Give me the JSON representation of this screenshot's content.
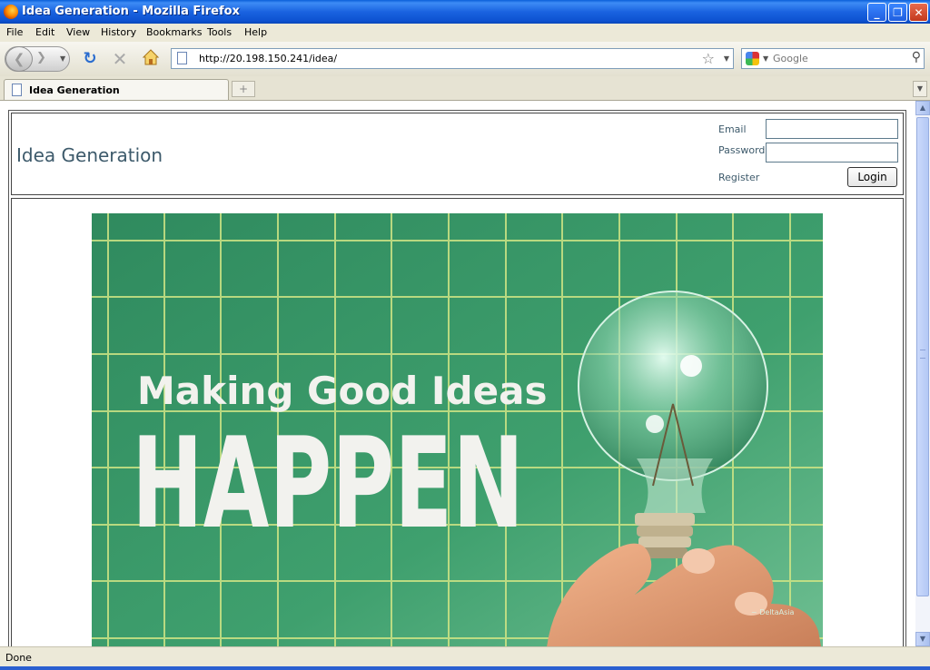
{
  "window": {
    "title": "Idea Generation - Mozilla Firefox",
    "minimize": "_",
    "maximize": "❐",
    "close": "✕"
  },
  "menu": [
    "File",
    "Edit",
    "View",
    "History",
    "Bookmarks",
    "Tools",
    "Help"
  ],
  "toolbar": {
    "url": "http://20.198.150.241/idea/",
    "search_placeholder": "Google"
  },
  "tab": {
    "label": "Idea Generation",
    "new_tab": "+"
  },
  "page": {
    "site_title": "Idea Generation",
    "email_label": "Email",
    "password_label": "Password",
    "register_label": "Register",
    "login_label": "Login",
    "hero": {
      "line1": "Making Good Ideas",
      "line2": "HAPPEN",
      "brand_mark": "~ DeltaAsia",
      "colors": {
        "board": "#3a9a6a",
        "grid": "#c9e07a",
        "letters": "#f2f2ee",
        "hand": "#e8a27a"
      }
    }
  },
  "status": {
    "text": "Done"
  }
}
